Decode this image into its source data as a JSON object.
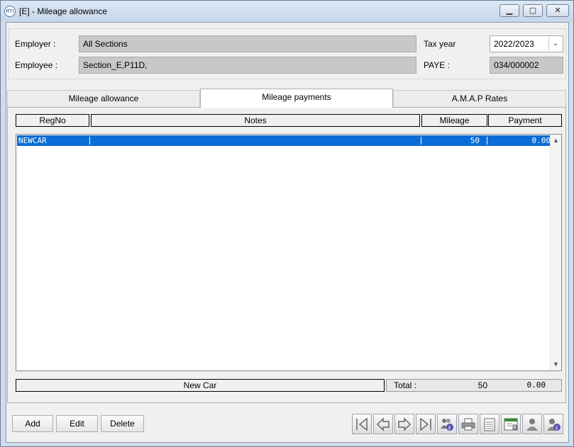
{
  "window": {
    "title": "[E] - Mileage allowance",
    "icon_text": "RTI"
  },
  "header": {
    "employer_label": "Employer :",
    "employer_value": "All Sections",
    "employee_label": "Employee :",
    "employee_value": "Section_E,P11D,",
    "taxyear_label": "Tax year",
    "taxyear_value": "2022/2023",
    "paye_label": "PAYE :",
    "paye_value": "034/000002"
  },
  "tabs": [
    {
      "label": "Mileage allowance",
      "active": false
    },
    {
      "label": "Mileage payments",
      "active": true
    },
    {
      "label": "A.M.A.P Rates",
      "active": false
    }
  ],
  "table": {
    "columns": [
      "RegNo",
      "Notes",
      "Mileage",
      "Payment"
    ],
    "rows": [
      {
        "regno": "NEWCAR",
        "notes": "",
        "mileage": "50",
        "payment": "0.00",
        "selected": true
      }
    ]
  },
  "footer": {
    "car_label": "New Car",
    "total_label": "Total :",
    "total_mileage": "50",
    "total_payment": "0.00"
  },
  "buttons": {
    "add": "Add",
    "edit": "Edit",
    "delete": "Delete"
  },
  "toolbar": [
    "first-record-icon",
    "previous-record-icon",
    "next-record-icon",
    "last-record-icon",
    "employees-payments-icon",
    "printer-icon",
    "notepad-icon",
    "calendar-report-icon",
    "employee-icon",
    "employee-pay-icon"
  ],
  "colors": {
    "selection": "#0a6cd6",
    "field_bg": "#c8c8c8"
  }
}
